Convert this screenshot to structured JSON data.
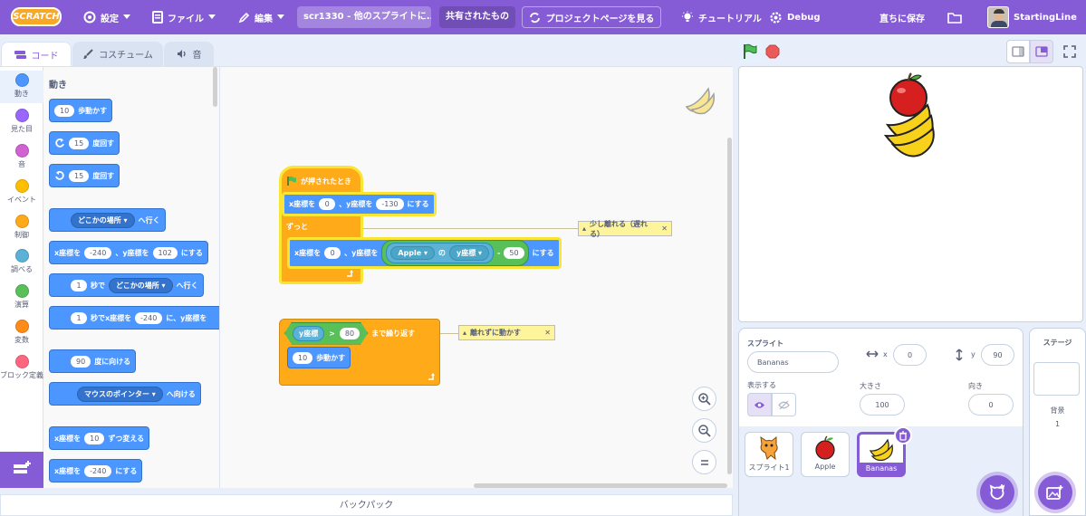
{
  "menubar": {
    "logo_text": "SCRATCH",
    "settings": "設定",
    "file": "ファイル",
    "edit": "編集",
    "project_title": "scr1330 - 他のスプライトに...",
    "share": "共有されたもの",
    "project_page": "プロジェクトページを見る",
    "tutorial": "チュートリアル",
    "debug": "Debug",
    "save_now": "直ちに保存",
    "username": "StartingLine"
  },
  "tabs": {
    "code": "コード",
    "costume": "コスチューム",
    "sound": "音"
  },
  "categories": [
    {
      "label": "動き",
      "color": "#4c97ff"
    },
    {
      "label": "見た目",
      "color": "#9966ff"
    },
    {
      "label": "音",
      "color": "#cf63cf"
    },
    {
      "label": "イベント",
      "color": "#ffbf00"
    },
    {
      "label": "制御",
      "color": "#ffab19"
    },
    {
      "label": "調べる",
      "color": "#5cb1d6"
    },
    {
      "label": "演算",
      "color": "#59c059"
    },
    {
      "label": "変数",
      "color": "#ff8c1a"
    },
    {
      "label": "ブロック定義",
      "color": "#ff6680"
    }
  ],
  "palette": {
    "heading": "動き",
    "move": {
      "value": "10",
      "label": "歩動かす"
    },
    "turn_right": {
      "value": "15",
      "label": "度回す"
    },
    "turn_left": {
      "value": "15",
      "label": "度回す"
    },
    "goto": {
      "menu": "どこかの場所",
      "label": "へ行く"
    },
    "gotoxy": {
      "x_label": "x座標を",
      "x": "-240",
      "y_label": "、y座標を",
      "y": "102",
      "suffix": "にする"
    },
    "glide": {
      "value": "1",
      "sec": "秒で",
      "menu": "どこかの場所",
      "label": "へ行く"
    },
    "glidexy": {
      "value": "1",
      "label": "秒でx座標を",
      "x": "-240",
      "mid": "に、y座標を"
    },
    "point": {
      "value": "90",
      "label": "度に向ける"
    },
    "pointto": {
      "menu": "マウスのポインター",
      "label": "へ向ける"
    },
    "changex": {
      "label": "x座標を",
      "value": "10",
      "suffix": "ずつ変える"
    },
    "setx": {
      "label": "x座標を",
      "value": "-240",
      "suffix": "にする"
    }
  },
  "script1": {
    "hat": "が押されたとき",
    "set_x_label": "x座標を",
    "set_x": "0",
    "set_y_label": "、y座標を",
    "set_y": "-130",
    "set_suffix": "にする",
    "forever": "ずっと",
    "inner_x_label": "x座標を",
    "inner_x": "0",
    "inner_y_label": "、y座標を",
    "of_sprite": "Apple",
    "of_word": "の",
    "of_attr": "y座標",
    "minus": "-",
    "minus_value": "50",
    "inner_suffix": "にする",
    "comment": "少し離れる（遅れる）"
  },
  "script2": {
    "repeat_attr": "y座標",
    "gt": ">",
    "gt_value": "80",
    "until_label": "まで繰り返す",
    "move_value": "10",
    "move_label": "歩動かす",
    "comment": "離れずに動かす"
  },
  "backpack": "バックパック",
  "sprite_info": {
    "sprite_label": "スプライト",
    "sprite_name": "Bananas",
    "x_label": "x",
    "x": "0",
    "y_label": "y",
    "y": "90",
    "show_label": "表示する",
    "size_label": "大きさ",
    "size": "100",
    "direction_label": "向き",
    "direction": "0"
  },
  "sprites": [
    {
      "name": "スプライト1"
    },
    {
      "name": "Apple"
    },
    {
      "name": "Bananas"
    }
  ],
  "stage_panel": {
    "title": "ステージ",
    "backdrop_label": "背景",
    "backdrop_count": "1"
  }
}
